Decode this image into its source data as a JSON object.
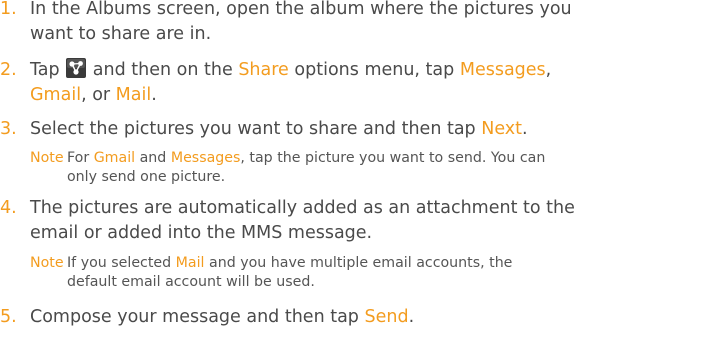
{
  "steps": [
    {
      "number": "1.",
      "line1": "In the Albums screen, open the album where the pictures you",
      "line2": "want to share are in."
    },
    {
      "number": "2.",
      "tap": "Tap",
      "middle": "and then on the",
      "share": "Share",
      "options": "options menu, tap",
      "messages": "Messages",
      "comma": ",",
      "gmail": "Gmail",
      "or": ", or",
      "mail": "Mail",
      "period": ".",
      "icon": "share-icon"
    },
    {
      "number": "3.",
      "text": "Select the pictures you want to share and then tap",
      "next": "Next",
      "period": ".",
      "note": {
        "label": "Note",
        "for": "For",
        "gmail": "Gmail",
        "and": "and",
        "messages": "Messages",
        "rest1": ", tap the picture you want to send. You can",
        "line2": "only send one picture."
      }
    },
    {
      "number": "4.",
      "line1": "The pictures are automatically added as an attachment to the",
      "line2": "email or added into the MMS message.",
      "note": {
        "label": "Note",
        "pre": "If you selected",
        "mail": "Mail",
        "rest1": "and you have multiple email accounts, the",
        "line2": "default email account will be used."
      }
    },
    {
      "number": "5.",
      "text": "Compose your message and then tap",
      "send": "Send",
      "period": "."
    }
  ],
  "colors": {
    "accent": "#f39c1f",
    "text": "#4a4a4a",
    "icon_bg": "#3a3a3a"
  }
}
